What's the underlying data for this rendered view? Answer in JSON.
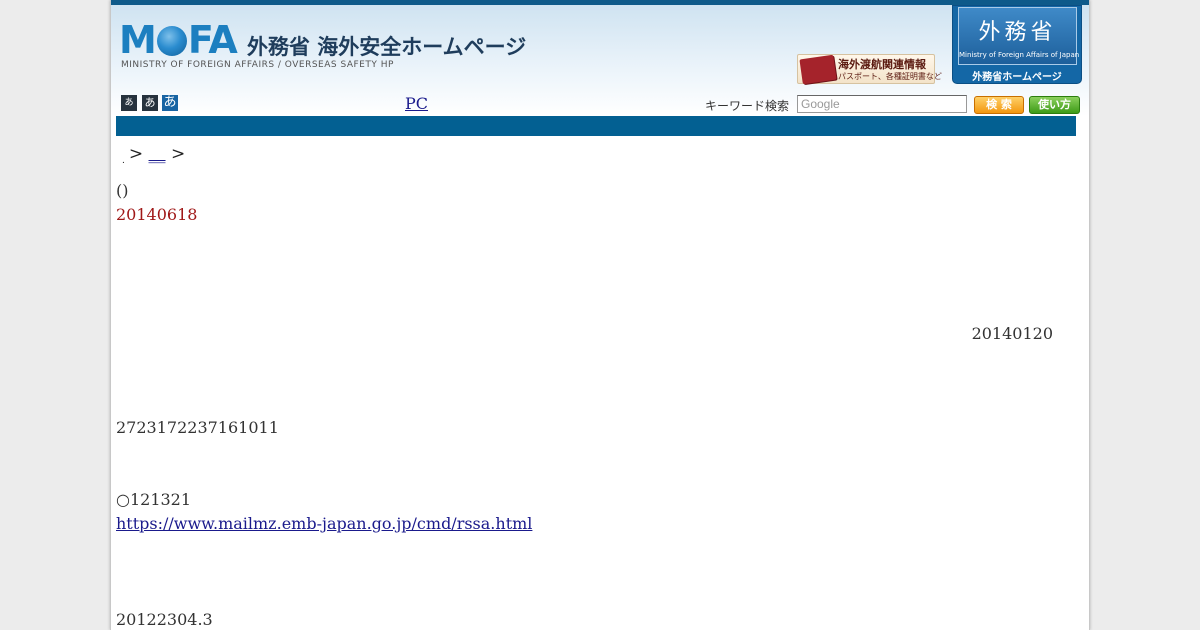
{
  "header": {
    "logo_mark_left": "M",
    "logo_mark_right": "FA",
    "logo_title": "外務省 海外安全ホームページ",
    "logo_subtitle": "MINISTRY OF FOREIGN AFFAIRS / OVERSEAS SAFETY HP",
    "passport_banner": {
      "title": "海外渡航関連情報",
      "subtitle": "パスポート、各種証明書など"
    },
    "mofa_badge": {
      "kanji": "外務省",
      "english": "Ministry of Foreign Affairs of Japan",
      "caption": "外務省ホームページ"
    }
  },
  "font_size_buttons": [
    "あ",
    "あ",
    "あ"
  ],
  "pc_link": "PC",
  "search": {
    "label": "キーワード検索",
    "placeholder": "Google",
    "button": "検 索",
    "help_button": "使い方"
  },
  "breadcrumb": {
    "dot": ".",
    "sep1": ">",
    "link": "__",
    "sep2": ">"
  },
  "content": {
    "paren": "()",
    "date": "20140618",
    "date2": "20140120",
    "number": "2723172237161011",
    "circle_line": "○121321",
    "link": "https://www.mailmz.emb-japan.go.jp/cmd/rssa.html",
    "last_line": "20122304.3"
  },
  "colors": {
    "nav_bar": "#036092",
    "date_red": "#a01818",
    "link_blue": "#1a1a8c",
    "search_button": "#f29710",
    "help_button": "#3e9b18"
  }
}
